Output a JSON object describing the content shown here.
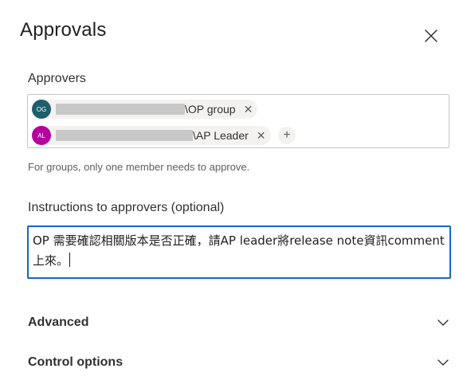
{
  "panel": {
    "title": "Approvals",
    "close_icon": "close-icon"
  },
  "approvers": {
    "label": "Approvers",
    "people": [
      {
        "initials": "OG",
        "suffix": "\\OP group",
        "avatar_color": "#1f5e6b",
        "remove_glyph": "✕"
      },
      {
        "initials": "AL",
        "suffix": "\\AP Leader",
        "avatar_color": "#b4009e",
        "remove_glyph": "✕"
      }
    ],
    "add_glyph": "+",
    "helper": "For groups, only one member needs to approve."
  },
  "instructions": {
    "label": "Instructions to approvers (optional)",
    "value": "OP 需要確認相關版本是否正確，請AP leader將release note資訊comment上來。"
  },
  "sections": {
    "advanced": "Advanced",
    "control_options": "Control options",
    "chevron_icon": "chevron-down-icon"
  },
  "colors": {
    "focus_border": "#0f6cbd"
  }
}
